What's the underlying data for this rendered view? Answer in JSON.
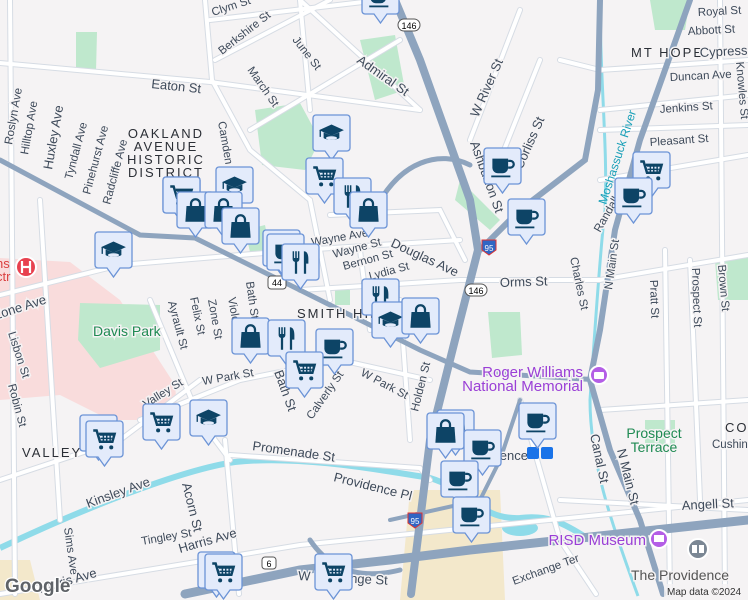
{
  "map": {
    "neighborhoods": {
      "oakland": [
        "OAKLAND",
        "AVENUE",
        "HISTORIC",
        "DISTRICT"
      ],
      "mt_hope": "MT HOPE",
      "smith_hill": "SMITH HILL",
      "valley": "VALLEY",
      "college_hill_partial": "CO"
    },
    "streets": {
      "clym": "Clym St",
      "berkshire": "Berkshire St",
      "june": "June St",
      "march": "March St",
      "eaton": "Eaton St",
      "admiral": "Admiral St",
      "roslyn": "Roslyn Ave",
      "hilltop": "Hilltop Ave",
      "huxley": "Huxley Ave",
      "tyndall": "Tyndall Ave",
      "pinehurst": "Pinehurst Ave",
      "radcliffe": "Radcliffe Ave",
      "camden": "Camden Ave",
      "w_river": "W River St",
      "ashburton": "Ashburton St",
      "corliss": "Corliss St",
      "royal": "Royal St",
      "abbott": "Abbott St",
      "cypress": "Cypress",
      "duncan": "Duncan Ave",
      "jenkins": "Jenkins St",
      "knowles": "Knowles St",
      "pleasant": "Pleasant St",
      "randall": "Randall St",
      "charles": "Charles St",
      "n_main": "N Main St",
      "orms": "Orms St",
      "douglas": "Douglas Ave",
      "wayne": "Wayne St",
      "bernon": "Bernon St",
      "lydia": "Lydia St",
      "pratt": "Pratt St",
      "prospect": "Prospect St",
      "brown": "Brown St",
      "zone_ave": "Zone Ave",
      "lisbon": "Lisbon St",
      "robin": "Robin St",
      "ayrault": "Ayrault St",
      "felix": "Felix St",
      "zone_st": "Zone St",
      "violet": "Violet",
      "bath": "Bath St",
      "w_park": "W Park St",
      "valley_st": "Valley St",
      "holden": "Holden St",
      "calverly": "Calverly St",
      "promenade": "Promenade St",
      "providence_pl": "Providence Pl",
      "kinsley": "Kinsley Ave",
      "acorn": "Acorn St",
      "sims": "Sims Ave",
      "tingley": "Tingley St",
      "harris": "Harris Ave",
      "w_exchange": "W Exchange St",
      "canal": "Canal St",
      "angell": "Angell St",
      "exchange_ter": "Exchange Ter",
      "cushing": "Cushing",
      "wayne_ave": "Wayne Ave"
    },
    "route_shields": {
      "r146": "146",
      "r44": "44",
      "i95": "95",
      "r6": "6"
    },
    "waterways": {
      "moshassuck": "Moshassuck River"
    },
    "parks": {
      "davis": "Davis Park",
      "prospect_terrace": [
        "Prospect",
        "Terrace"
      ]
    },
    "pois": {
      "roger_williams": [
        "Roger Williams",
        "National Memorial"
      ],
      "risd": "RISD Museum",
      "providence_station": "Providence",
      "athenaeum": "The Providence",
      "hospital_partial": [
        "ns",
        "ctr"
      ]
    },
    "markers": [
      "coffee",
      "education",
      "cart",
      "cart",
      "fork",
      "bag",
      "cart",
      "education",
      "bag",
      "bag",
      "bag",
      "education",
      "coffee",
      "coffee",
      "fork",
      "fork",
      "education",
      "bag",
      "bag",
      "fork",
      "coffee",
      "cart",
      "cart",
      "cart",
      "cart",
      "education",
      "bag",
      "bag",
      "coffee",
      "coffee",
      "coffee",
      "coffee",
      "coffee",
      "coffee",
      "cart",
      "coffee",
      "cart",
      "cart",
      "cart"
    ],
    "colors": {
      "marker_fill": "#e3ebfb",
      "marker_stroke": "#6b93d6",
      "marker_icon": "#0d4466",
      "highway": "#8ea4be",
      "park": "#bfe8cd",
      "water": "#8fdbe9",
      "poi": "#9a3fd6"
    },
    "credit": "Map data ©2024",
    "logo": "Google"
  }
}
